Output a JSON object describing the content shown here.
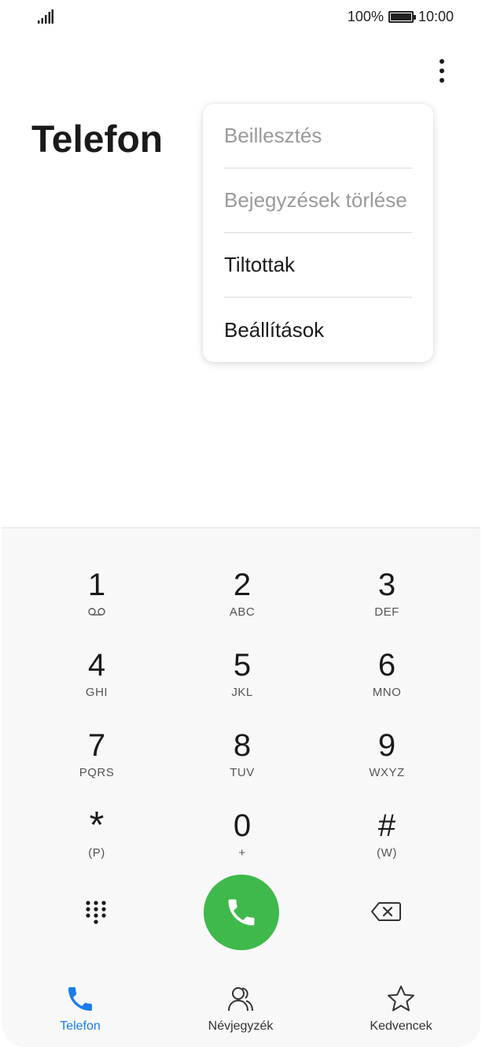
{
  "status_bar": {
    "battery": "100%",
    "time": "10:00"
  },
  "header": {
    "title": "Telefon"
  },
  "menu": {
    "items": [
      {
        "label": "Beillesztés",
        "enabled": false
      },
      {
        "label": "Bejegyzések törlése",
        "enabled": false
      },
      {
        "label": "Tiltottak",
        "enabled": true
      },
      {
        "label": "Beállítások",
        "enabled": true
      }
    ]
  },
  "dialpad": {
    "keys": [
      {
        "digit": "1",
        "letters": ""
      },
      {
        "digit": "2",
        "letters": "ABC"
      },
      {
        "digit": "3",
        "letters": "DEF"
      },
      {
        "digit": "4",
        "letters": "GHI"
      },
      {
        "digit": "5",
        "letters": "JKL"
      },
      {
        "digit": "6",
        "letters": "MNO"
      },
      {
        "digit": "7",
        "letters": "PQRS"
      },
      {
        "digit": "8",
        "letters": "TUV"
      },
      {
        "digit": "9",
        "letters": "WXYZ"
      },
      {
        "digit": "*",
        "letters": "(P)"
      },
      {
        "digit": "0",
        "letters": "+"
      },
      {
        "digit": "#",
        "letters": "(W)"
      }
    ]
  },
  "bottom_nav": {
    "tabs": [
      {
        "label": "Telefon",
        "icon": "phone-icon",
        "active": true
      },
      {
        "label": "Névjegyzék",
        "icon": "contacts-icon",
        "active": false
      },
      {
        "label": "Kedvencek",
        "icon": "star-icon",
        "active": false
      }
    ]
  },
  "colors": {
    "accent": "#1a7cf0",
    "call": "#3fb94b"
  }
}
